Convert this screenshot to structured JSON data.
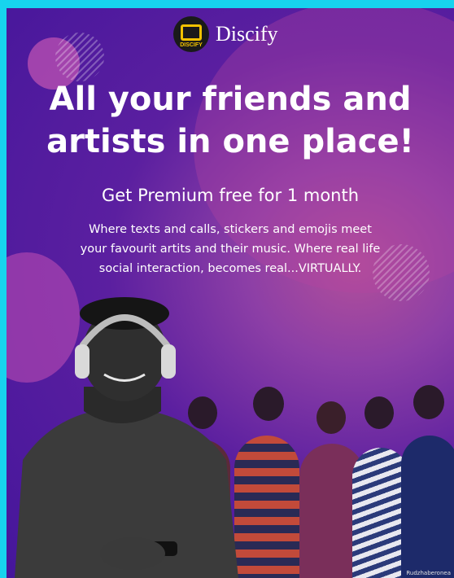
{
  "brand": {
    "name": "Discify",
    "badge_text": "DISCIFY",
    "logo_icon": "discify-logo-icon",
    "accent": "#f2c200"
  },
  "headline": {
    "line1": "All your friends and",
    "line2": "artists in one place!"
  },
  "subheadline": "Get Premium free for 1 month",
  "description": {
    "line1": "Where texts and calls, stickers and emojis meet",
    "line2": "your favourit artits and their music. Where real life",
    "line3": "social interaction, becomes real...VIRTUALLY."
  },
  "colors": {
    "border": "#17d3ee",
    "background_deep": "#45169b",
    "background_glow": "#b24f9a"
  },
  "watermark": "Rudzhaberonea"
}
